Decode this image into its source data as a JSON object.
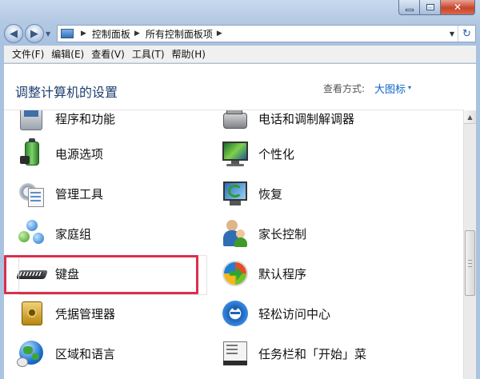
{
  "window": {
    "caption": {
      "minimize": "—",
      "maximize": "□",
      "close": "✕"
    }
  },
  "nav": {
    "back_icon": "back-arrow-icon",
    "forward_icon": "forward-arrow-icon",
    "breadcrumbs": [
      "控制面板",
      "所有控制面板项"
    ],
    "separator": "▶",
    "dropdown": "▼",
    "refresh": "↻"
  },
  "menu": [
    "文件(F)",
    "编辑(E)",
    "查看(V)",
    "工具(T)",
    "帮助(H)"
  ],
  "header": {
    "title": "调整计算机的设置",
    "view_by_label": "查看方式:",
    "view_by_value": "大图标",
    "view_by_arrow": "▾"
  },
  "items": [
    {
      "label": "程序和功能",
      "icon": "programs-features-icon"
    },
    {
      "label": "电话和调制解调器",
      "icon": "phone-modem-icon"
    },
    {
      "label": "电源选项",
      "icon": "power-options-icon"
    },
    {
      "label": "个性化",
      "icon": "personalization-icon"
    },
    {
      "label": "管理工具",
      "icon": "admin-tools-icon"
    },
    {
      "label": "恢复",
      "icon": "recovery-icon"
    },
    {
      "label": "家庭组",
      "icon": "homegroup-icon"
    },
    {
      "label": "家长控制",
      "icon": "parental-controls-icon"
    },
    {
      "label": "键盘",
      "icon": "keyboard-icon"
    },
    {
      "label": "默认程序",
      "icon": "default-programs-icon"
    },
    {
      "label": "凭据管理器",
      "icon": "credential-manager-icon"
    },
    {
      "label": "轻松访问中心",
      "icon": "ease-of-access-icon"
    },
    {
      "label": "区域和语言",
      "icon": "region-language-icon"
    },
    {
      "label": "任务栏和「开始」菜",
      "icon": "taskbar-start-icon"
    }
  ],
  "scrollbar": {
    "up_arrow": "▲"
  },
  "colors": {
    "highlight": "#d9304d",
    "link": "#0e63c8",
    "title": "#1f3f6f"
  }
}
